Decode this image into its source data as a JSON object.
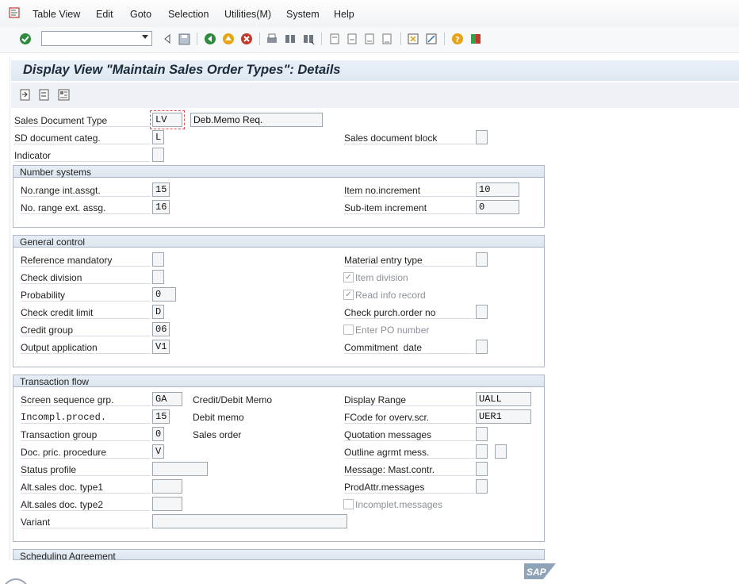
{
  "menu": {
    "items": [
      "Table View",
      "Edit",
      "Goto",
      "Selection",
      "Utilities(M)",
      "System",
      "Help"
    ]
  },
  "toolbar": {
    "command_field_value": ""
  },
  "screen": {
    "title": "Display View \"Maintain Sales Order Types\": Details"
  },
  "header_fields": {
    "sales_doc_type_label": "Sales Document Type",
    "sales_doc_type_value": "LV",
    "sales_doc_type_desc": "Deb.Memo Req.",
    "sd_doc_categ_label": "SD document categ.",
    "sd_doc_categ_value": "L",
    "indicator_label": "Indicator",
    "indicator_value": "",
    "sales_doc_block_label": "Sales document block",
    "sales_doc_block_value": ""
  },
  "number_systems": {
    "title": "Number systems",
    "int_assgt_label": "No.range int.assgt.",
    "int_assgt_value": "15",
    "ext_assg_label": "No. range ext. assg.",
    "ext_assg_value": "16",
    "item_incr_label": "Item no.increment",
    "item_incr_value": "10",
    "subitem_incr_label": "Sub-item increment",
    "subitem_incr_value": "0"
  },
  "general_control": {
    "title": "General control",
    "ref_mandatory_label": "Reference mandatory",
    "ref_mandatory_value": "",
    "check_division_label": "Check division",
    "check_division_value": "",
    "probability_label": "Probability",
    "probability_value": "0",
    "check_credit_label": "Check credit limit",
    "check_credit_value": "D",
    "credit_group_label": "Credit group",
    "credit_group_value": "06",
    "output_app_label": "Output application",
    "output_app_value": "V1",
    "material_entry_label": "Material entry type",
    "material_entry_value": "",
    "item_division_label": "Item division",
    "item_division_checked": "✓",
    "read_info_label": "Read info record",
    "read_info_checked": "✓",
    "check_po_label": "Check purch.order no",
    "check_po_value": "",
    "enter_po_label": "Enter PO number",
    "commitment_label": "Commitment  date",
    "commitment_value": ""
  },
  "transaction_flow": {
    "title": "Transaction flow",
    "screen_seq_label": "Screen sequence grp.",
    "screen_seq_value": "GA",
    "screen_seq_desc": "Credit/Debit Memo",
    "incompl_label": "Incompl.proced.",
    "incompl_value": "15",
    "incompl_desc": "Debit memo",
    "trans_group_label": "Transaction group",
    "trans_group_value": "0",
    "trans_group_desc": "Sales order",
    "doc_pric_label": "Doc. pric. procedure",
    "doc_pric_value": "V",
    "status_profile_label": "Status profile",
    "status_profile_value": "",
    "alt_type1_label": "Alt.sales doc. type1",
    "alt_type1_value": "",
    "alt_type2_label": "Alt.sales doc. type2",
    "alt_type2_value": "",
    "variant_label": "Variant",
    "variant_value": "",
    "display_range_label": "Display Range",
    "display_range_value": "UALL",
    "fcode_label": "FCode for overv.scr.",
    "fcode_value": "UER1",
    "quotation_label": "Quotation messages",
    "quotation_value": "",
    "outline_label": "Outline agrmt mess.",
    "outline_value": "",
    "outline_value2": "",
    "mast_contr_label": "Message: Mast.contr.",
    "mast_contr_value": "",
    "prodattr_label": "ProdAttr.messages",
    "prodattr_value": "",
    "incomplet_label": "Incomplet.messages"
  },
  "scheduling": {
    "title": "Scheduling Agreement"
  },
  "footer": {
    "logo_text": "SAP"
  }
}
